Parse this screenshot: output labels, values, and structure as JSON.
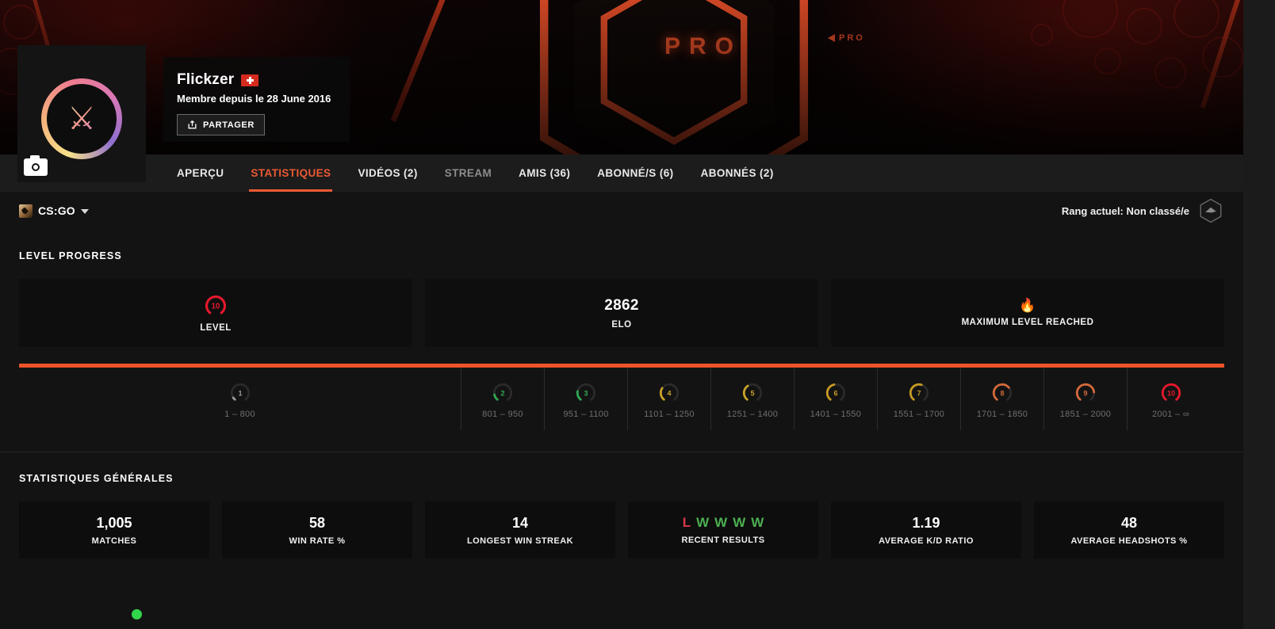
{
  "profile": {
    "username": "Flickzer",
    "country_flag": "swiss-flag",
    "member_since": "Membre depuis le 28 June 2016",
    "share_label": "PARTAGER",
    "avatar_emblem": "csgo-avatar",
    "status": "online"
  },
  "banner": {
    "hex_label": "PRO",
    "logo_label": "PRO"
  },
  "tabs": [
    {
      "label": "APERÇU",
      "state": "normal"
    },
    {
      "label": "STATISTIQUES",
      "state": "active"
    },
    {
      "label": "VIDÉOS (2)",
      "state": "normal"
    },
    {
      "label": "STREAM",
      "state": "muted"
    },
    {
      "label": "AMIS  (36)",
      "state": "normal"
    },
    {
      "label": "ABONNÉ/S (6)",
      "state": "normal"
    },
    {
      "label": "ABONNÉS  (2)",
      "state": "normal"
    }
  ],
  "game_bar": {
    "game": "CS:GO",
    "rank_label": "Rang actuel: Non classé/e"
  },
  "level_progress": {
    "title": "LEVEL PROGRESS",
    "cards": [
      {
        "value": "",
        "label": "LEVEL",
        "icon": "level-10-badge"
      },
      {
        "value": "2862",
        "label": "ELO",
        "icon": ""
      },
      {
        "value": "",
        "label": "MAXIMUM LEVEL REACHED",
        "icon": "🔥"
      }
    ],
    "progress_percent": 100,
    "ladder": [
      {
        "level": "1",
        "range": "1 – 800",
        "color": "#9a9a9a",
        "fill": 0.06
      },
      {
        "level": "2",
        "range": "801 – 950",
        "color": "#32a852",
        "fill": 0.14
      },
      {
        "level": "3",
        "range": "951 – 1100",
        "color": "#32a852",
        "fill": 0.22
      },
      {
        "level": "4",
        "range": "1101 – 1250",
        "color": "#c9a227",
        "fill": 0.3
      },
      {
        "level": "5",
        "range": "1251 – 1400",
        "color": "#c9a227",
        "fill": 0.38
      },
      {
        "level": "6",
        "range": "1401 – 1550",
        "color": "#c79a22",
        "fill": 0.46
      },
      {
        "level": "7",
        "range": "1551 – 1700",
        "color": "#c79a22",
        "fill": 0.56
      },
      {
        "level": "8",
        "range": "1701 – 1850",
        "color": "#d4693a",
        "fill": 0.68
      },
      {
        "level": "9",
        "range": "1851 – 2000",
        "color": "#d4693a",
        "fill": 0.8
      },
      {
        "level": "10",
        "range": "2001 – ∞",
        "color": "#e8182c",
        "fill": 1.0
      }
    ]
  },
  "general_stats": {
    "title": "STATISTIQUES GÉNÉRALES",
    "cards": [
      {
        "value": "1,005",
        "label": "MATCHES"
      },
      {
        "value": "58",
        "label": "WIN RATE %"
      },
      {
        "value": "14",
        "label": "LONGEST WIN STREAK"
      },
      {
        "value": "",
        "label": "RECENT RESULTS",
        "results": [
          "L",
          "W",
          "W",
          "W",
          "W"
        ]
      },
      {
        "value": "1.19",
        "label": "AVERAGE K/D RATIO"
      },
      {
        "value": "48",
        "label": "AVERAGE HEADSHOTS %"
      }
    ]
  },
  "colors": {
    "accent": "#ec5a34",
    "progress": "#f0532c",
    "win": "#4caf50",
    "loss": "#d9384a",
    "online": "#32d74b"
  }
}
